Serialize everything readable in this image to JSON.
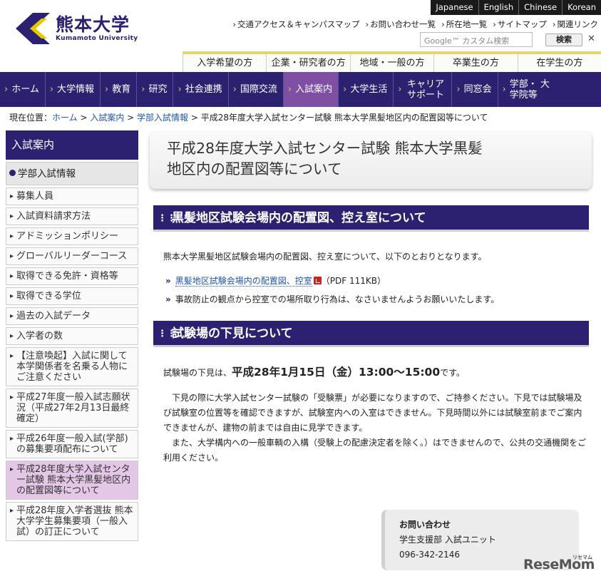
{
  "header": {
    "languages": [
      "Japanese",
      "English",
      "Chinese",
      "Korean"
    ],
    "logo_ja": "熊本大学",
    "logo_en": "Kumamoto University",
    "util_links": [
      "交通アクセス＆キャンパスマップ",
      "お問い合わせ一覧",
      "所在地一覧",
      "サイトマップ",
      "関連リンク"
    ],
    "search_placeholder": "Google™ カスタム検索",
    "search_button": "検索",
    "close": "✕",
    "audience_tabs": [
      "入学希望の方",
      "企業・研究者の方",
      "地域・一般の方",
      "卒業生の方",
      "在学生の方"
    ],
    "main_nav": [
      "ホーム",
      "大学情報",
      "教育",
      "研究",
      "社会連携",
      "国際交流",
      "入試案内",
      "大学生活",
      "キャリア サポート",
      "同窓会",
      "学部・ 大学院等"
    ]
  },
  "breadcrumb": {
    "prefix": "現在位置：",
    "links": [
      "ホーム",
      "入試案内",
      "学部入試情報"
    ],
    "sep": " > ",
    "current": "平成28年度大学入試センター試験 熊本大学黒髪地区内の配置図等について"
  },
  "sidebar": {
    "heading": "入試案内",
    "sub": "学部入試情報",
    "items": [
      "募集人員",
      "入試資料請求方法",
      "アドミッションポリシー",
      "グローバルリーダーコース",
      "取得できる免許・資格等",
      "取得できる学位",
      "過去の入試データ",
      "入学者の数",
      "【注意喚起】入試に関して本学関係者を名乗る人物にご注意ください",
      "平成27年度一般入試志願状況（平成27年2月13日最終確定）",
      "平成26年度一般入試(学部)の募集要項配布について",
      "平成28年度大学入試センター試験 熊本大学黒髪地区内の配置図等について",
      "平成28年度入学者選抜 熊本大学学生募集要項（一般入試）の訂正について"
    ]
  },
  "main": {
    "title_line1": "平成28年度大学入試センター試験 熊本大学黒髪",
    "title_line2": "地区内の配置図等について",
    "section1_heading": "黒髪地区試験会場内の配置図、控え室について",
    "section1_intro": "熊本大学黒髪地区試験会場内の配置図、控え室について、以下のとおりとなります。",
    "bullet1_link": "黒髪地区試験会場内の配置図、控室",
    "bullet1_meta": "（PDF 111KB）",
    "bullet2": "事故防止の観点から控室での場所取り行為は、なさいませんようお願いいたします。",
    "section2_heading": "試験場の下見について",
    "date_prefix": "試験場の下見は、",
    "date_value": "平成28年1月15日（金）13:00〜15:00",
    "date_suffix": "です。",
    "para1": "下見の際に大学入試センター試験の「受験票」が必要になりますので、ご持参ください。下見では試験場及び試験室の位置等を確認できますが、試験室内への入室はできません。下見時間以外には試験室前までご案内できませんが、建物の前までは自由に見学できます。",
    "para2": "また、大学構内への一般車輌の入構（受験上の配慮決定者を除く。）はできませんので、公共の交通機関をご利用ください。"
  },
  "contact": {
    "heading": "お問い合わせ",
    "dept": "学生支援部 入試ユニット",
    "phone": "096-342-2146"
  },
  "watermark": {
    "text": "ReseMom",
    "small": "リセマム"
  },
  "colors": {
    "brand": "#2b2170",
    "accent_gold": "#e6d670",
    "active_nav": "#7e4fa3",
    "current_side": "#e4c6e6",
    "link": "#2255aa"
  }
}
